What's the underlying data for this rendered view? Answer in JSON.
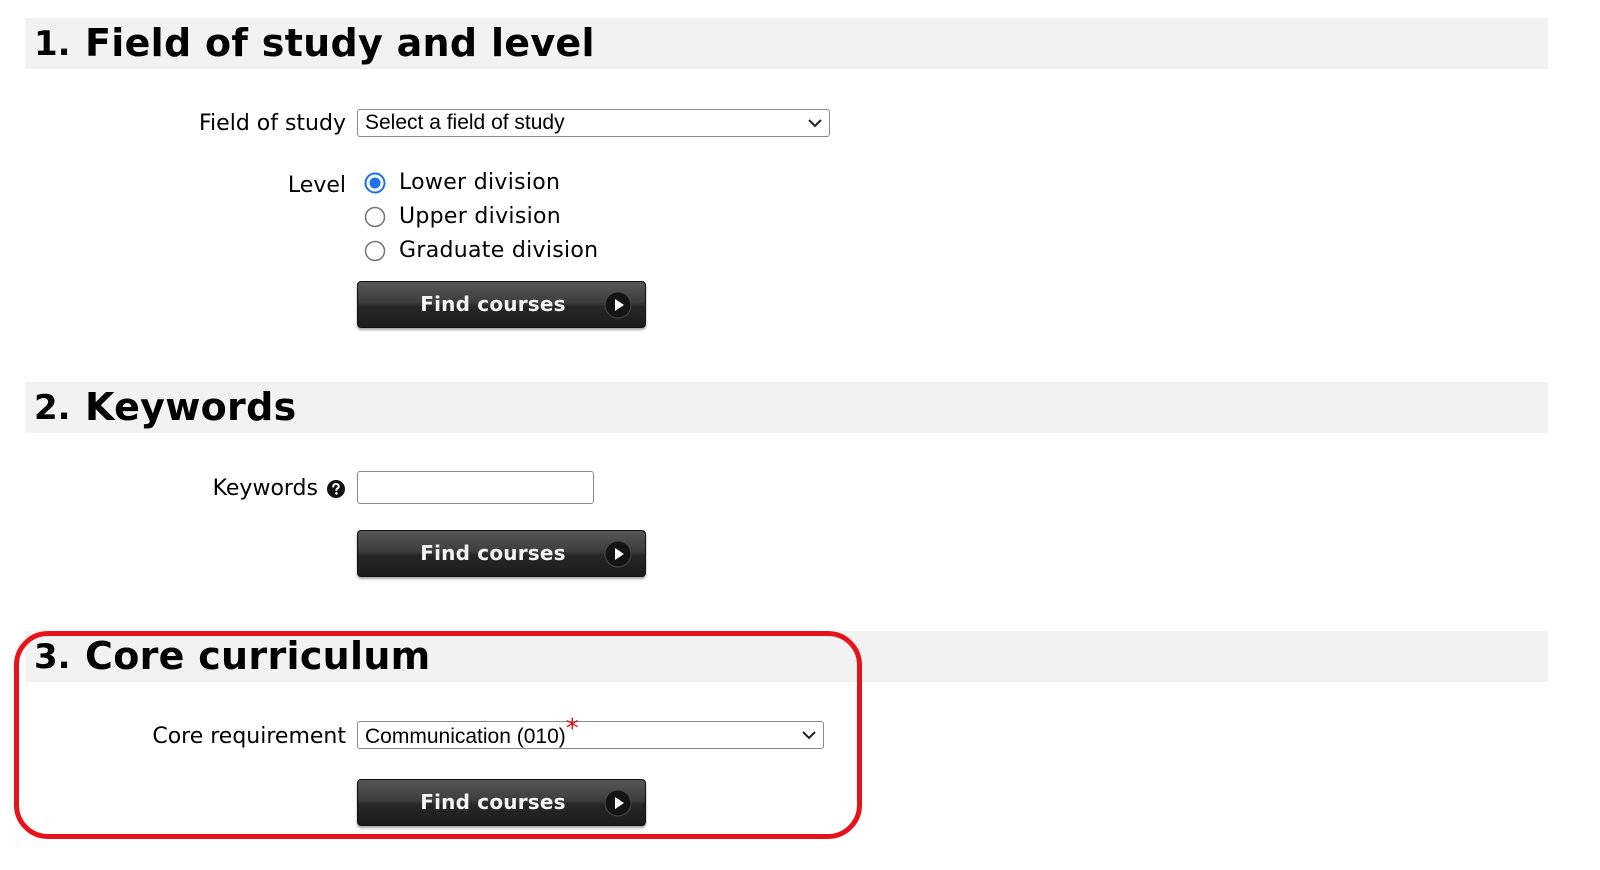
{
  "section1": {
    "number": "1.",
    "title": "Field of study and level",
    "field_label": "Field of study",
    "field_select_value": "Select a field of study",
    "level_label": "Level",
    "level_options": [
      {
        "label": "Lower division",
        "selected": true
      },
      {
        "label": "Upper division",
        "selected": false
      },
      {
        "label": "Graduate division",
        "selected": false
      }
    ],
    "button_label": "Find courses"
  },
  "section2": {
    "number": "2.",
    "title": "Keywords",
    "keywords_label": "Keywords",
    "keywords_value": "",
    "button_label": "Find courses"
  },
  "section3": {
    "number": "3.",
    "title": "Core curriculum",
    "core_label": "Core requirement",
    "core_select_value": "Communication (010)",
    "asterisk": "*",
    "button_label": "Find courses"
  },
  "colors": {
    "section_bg": "#f2f2f2",
    "radio_selected": "#1a73e8",
    "highlight": "#e8121a",
    "button_dark": "#262626"
  }
}
